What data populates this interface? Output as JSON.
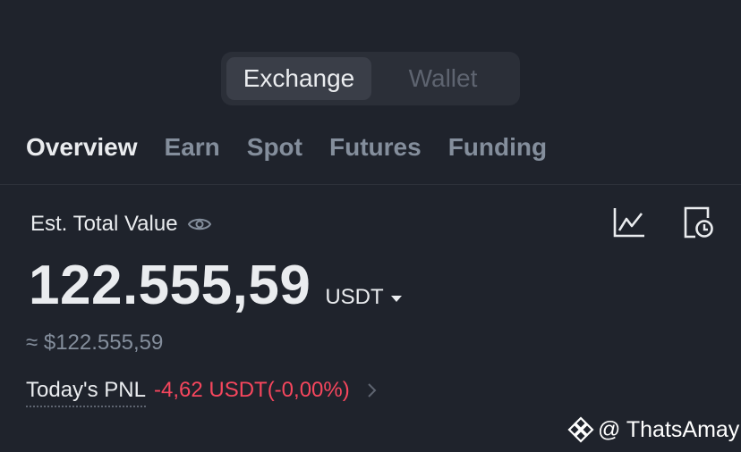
{
  "account_switch": {
    "options": [
      "Exchange",
      "Wallet"
    ],
    "selected": "Exchange"
  },
  "tabs": [
    {
      "label": "Overview",
      "active": true
    },
    {
      "label": "Earn",
      "active": false
    },
    {
      "label": "Spot",
      "active": false
    },
    {
      "label": "Futures",
      "active": false
    },
    {
      "label": "Funding",
      "active": false
    }
  ],
  "summary": {
    "label": "Est. Total Value",
    "balance": "122.555,59",
    "currency": "USDT",
    "approx_fiat": "≈ $122.555,59",
    "pnl_label": "Today's PNL",
    "pnl_value": "-4,62 USDT(-0,00%)"
  },
  "icons": {
    "visibility": "eye-icon",
    "chart": "line-chart-icon",
    "history": "history-icon",
    "pnl_details": "chevron-right-icon"
  },
  "watermark": {
    "text": "@ ThatsAmay"
  },
  "colors": {
    "background": "#1f232c",
    "text_primary": "#eaecef",
    "text_secondary": "#848e9c",
    "negative": "#f6465d"
  }
}
